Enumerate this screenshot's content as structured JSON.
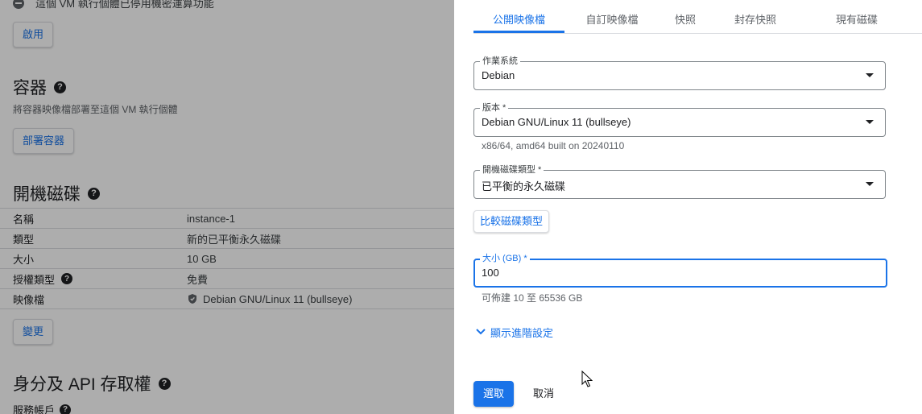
{
  "left": {
    "top_note": "這個 VM 執行個體已停用機密運算功能",
    "enable_button": "啟用",
    "containers": {
      "title": "容器",
      "description": "將容器映像檔部署至這個 VM 執行個體",
      "deploy_button": "部署容器"
    },
    "boot_disk": {
      "title": "開機磁碟",
      "rows": [
        {
          "key": "名稱",
          "value": "instance-1"
        },
        {
          "key": "類型",
          "value": "新的已平衡永久磁碟"
        },
        {
          "key": "大小",
          "value": "10 GB"
        },
        {
          "key": "授權類型",
          "value": "免費"
        },
        {
          "key": "映像檔",
          "value": "Debian GNU/Linux 11 (bullseye)"
        }
      ],
      "change_button": "變更"
    },
    "iam": {
      "title": "身分及 API 存取權",
      "service_account": "服務帳戶"
    }
  },
  "panel": {
    "tabs": [
      {
        "label": "公開映像檔",
        "active": true
      },
      {
        "label": "自訂映像檔",
        "active": false
      },
      {
        "label": "快照",
        "active": false
      },
      {
        "label": "封存快照",
        "active": false
      },
      {
        "label": "現有磁碟",
        "active": false
      }
    ],
    "os": {
      "label": "作業系統",
      "value": "Debian"
    },
    "version": {
      "label": "版本 *",
      "value": "Debian GNU/Linux 11 (bullseye)",
      "hint": "x86/64, amd64 built on 20240110"
    },
    "disk_type": {
      "label": "開機磁碟類型 *",
      "value": "已平衡的永久磁碟"
    },
    "compare_button": "比較磁碟類型",
    "size": {
      "label": "大小 (GB) *",
      "value": "100",
      "hint": "可佈建 10 至 65536 GB"
    },
    "advanced_link": "顯示進階設定",
    "select_button": "選取",
    "cancel_button": "取消"
  },
  "colors": {
    "accent": "#1a73e8",
    "scrim": "rgba(0,0,0,0.32)"
  }
}
